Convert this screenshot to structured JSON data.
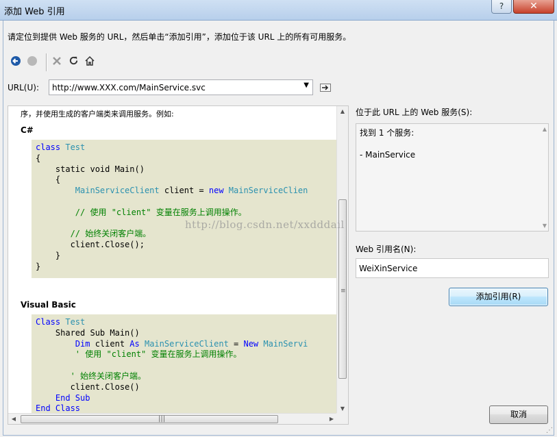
{
  "window": {
    "title": "添加 Web 引用",
    "help_label": "?",
    "close_label": "✕"
  },
  "intro_text": "请定位到提供 Web 服务的 URL，然后单击“添加引用”，添加位于该 URL 上的所有可用服务。",
  "toolbar": {
    "back_icon": "back-icon",
    "stop_icon": "stop-icon",
    "delete_icon": "delete-icon",
    "refresh_icon": "refresh-icon",
    "home_icon": "home-icon"
  },
  "url": {
    "label": "URL(U):",
    "value": "http://www.XXX.com/MainService.svc"
  },
  "doc": {
    "intro_line": "序，并使用生成的客户端类来调用服务。例如:",
    "csharp_header": "C#",
    "vb_header": "Visual Basic",
    "csharp_code": [
      [
        "class ",
        "Test"
      ],
      [
        "{"
      ],
      [
        "    static void ",
        "Main()"
      ],
      [
        "    {"
      ],
      [
        "        MainServiceClient ",
        "client = ",
        "new ",
        "MainServiceClien"
      ],
      [
        ""
      ],
      [
        "        // 使用 \"client\" 变量在服务上调用操作。"
      ],
      [
        ""
      ],
      [
        "       // 始终关闭客户端。"
      ],
      [
        "       client.Close();"
      ],
      [
        "    }"
      ],
      [
        "}"
      ]
    ],
    "vb_code": [
      [
        "Class ",
        "Test"
      ],
      [
        "    Shared Sub ",
        "Main()"
      ],
      [
        "        Dim ",
        "client ",
        "As ",
        "MainServiceClient ",
        "= ",
        "New ",
        "MainServi"
      ],
      [
        "        ' 使用 \"client\" 变量在服务上调用操作。"
      ],
      [
        ""
      ],
      [
        "       ' 始终关闭客户端。"
      ],
      [
        "       client.Close()"
      ],
      [
        "    End Sub"
      ],
      [
        "End Class"
      ]
    ]
  },
  "services": {
    "label": "位于此 URL 上的 Web 服务(S):",
    "found_text": "找到 1 个服务:",
    "items": [
      "- MainService"
    ]
  },
  "reference_name": {
    "label": "Web 引用名(N):",
    "value": "WeiXinService"
  },
  "buttons": {
    "add_reference": "添加引用(R)",
    "cancel": "取消"
  },
  "watermark": "http://blog.csdn.net/xxdddail"
}
